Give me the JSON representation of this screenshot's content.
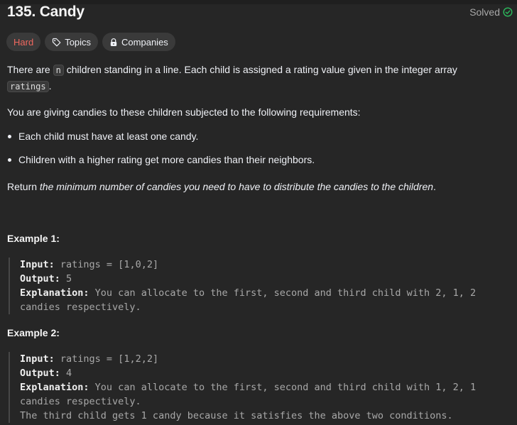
{
  "problem": {
    "title": "135. Candy",
    "status_label": "Solved",
    "status_icon": "check-circle-icon",
    "status_color": "#2cbb5d"
  },
  "tags": {
    "difficulty": "Hard",
    "difficulty_color": "#f0685f",
    "topics": "Topics",
    "topics_icon": "tag-icon",
    "companies": "Companies",
    "companies_icon": "lock-icon"
  },
  "description": {
    "p1_a": "There are ",
    "p1_code1": "n",
    "p1_b": " children standing in a line. Each child is assigned a rating value given in the integer array",
    "p1_code2": "ratings",
    "p1_c": ".",
    "p2": "You are giving candies to these children subjected to the following requirements:",
    "bullets": [
      "Each child must have at least one candy.",
      "Children with a higher rating get more candies than their neighbors."
    ],
    "p3_a": "Return ",
    "p3_em": "the minimum number of candies you need to have to distribute the candies to the children",
    "p3_b": "."
  },
  "examples": [
    {
      "title": "Example 1:",
      "input_label": "Input:",
      "input": " ratings = [1,0,2]",
      "output_label": "Output:",
      "output": " 5",
      "explanation_label": "Explanation:",
      "explanation_1": " You can allocate to the first, second and third child with 2, 1, 2",
      "explanation_2": "candies respectively."
    },
    {
      "title": "Example 2:",
      "input_label": "Input:",
      "input": " ratings = [1,2,2]",
      "output_label": "Output:",
      "output": " 4",
      "explanation_label": "Explanation:",
      "explanation_1": " You can allocate to the first, second and third child with 1, 2, 1",
      "explanation_2": "candies respectively.",
      "explanation_3": "The third child gets 1 candy because it satisfies the above two conditions."
    }
  ]
}
